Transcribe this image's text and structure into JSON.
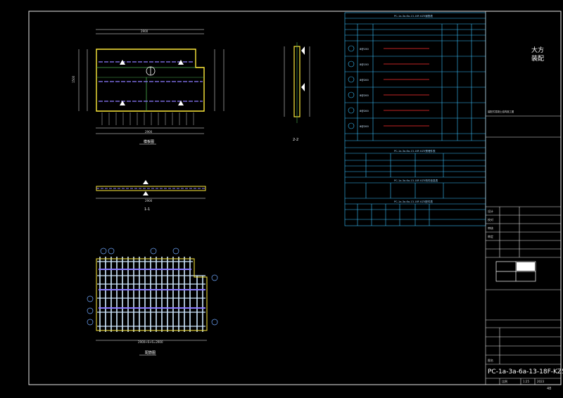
{
  "drawing": {
    "sheet_title": "PC-1a-3a-6a-13-18F-KZ5详图",
    "brand_text": "大方装配",
    "page_number": "48",
    "views": {
      "plan_label": "模板图",
      "section_1_label": "1-1",
      "section_2_label": "2-2",
      "rebar_label": "配筋图",
      "plan_width_dim": "2900",
      "plan_height_dim": "1500",
      "rebar_dim": "2900+6+6=2900"
    },
    "tables": {
      "rebar_table_title": "PC-1a-3a-6a-13-18F-KZ5钢筋表",
      "rebar_headers": [
        "编号",
        "规格",
        "钢筋形状",
        "长度(mm)",
        "数量",
        "重量(kg)",
        "备注"
      ],
      "rebar_rows": [
        {
          "id": "1",
          "spec": "8@150"
        },
        {
          "id": "2",
          "spec": "8@150"
        },
        {
          "id": "3",
          "spec": "8@200"
        },
        {
          "id": "4",
          "spec": "8@200"
        },
        {
          "id": "5",
          "spec": "8@200"
        },
        {
          "id": "6",
          "spec": "8@200"
        },
        {
          "id": "7",
          "spec": "8@200"
        },
        {
          "id": "8",
          "spec": "8@200"
        }
      ],
      "embed_table_title": "PC-1a-3a-6a-13-18F-KZ5预埋件表",
      "embed_headers": [
        "编号",
        "名称",
        "规格",
        "数量",
        "单重(kg)",
        "总重(kg)"
      ],
      "info_table_title": "PC-1a-3a-6a-13-18F-KZ5构件信息表",
      "part_table_title": "PC-1a-3a-6a-13-18F-KZ5配件表",
      "part_headers": [
        "编号",
        "数量",
        "规格",
        "长度",
        "单重",
        "备注"
      ]
    },
    "title_block": {
      "project_label": "装配式混凝土结构施工图",
      "drawing_name_label": "图名",
      "designer_label": "设计",
      "checker_label": "校对",
      "reviewer_label": "审核",
      "approver_label": "审定",
      "scale_label": "比例",
      "sheet_label": "图号",
      "date_label": "日期",
      "scale_value": "1:25",
      "date_value": "2023"
    }
  }
}
